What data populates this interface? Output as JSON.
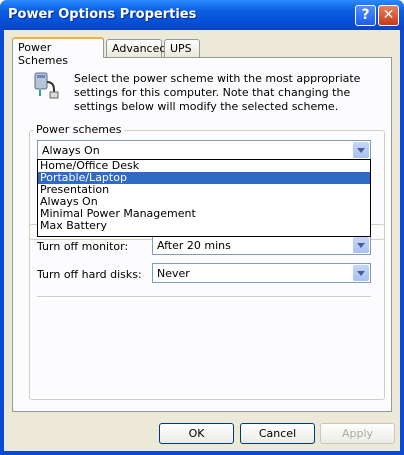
{
  "window": {
    "title": "Power Options Properties"
  },
  "titlebar": {
    "help": "?",
    "close": "✕"
  },
  "tabs": [
    "Power Schemes",
    "Advanced",
    "UPS"
  ],
  "intro_text": "Select the power scheme with the most appropriate settings for this computer. Note that changing the settings below will modify the selected scheme.",
  "power_schemes": {
    "legend": "Power schemes",
    "selected": "Always On",
    "options": [
      "Home/Office Desk",
      "Portable/Laptop",
      "Presentation",
      "Always On",
      "Minimal Power Management",
      "Max Battery"
    ],
    "highlighted_index": 1
  },
  "settings": {
    "monitor_label": "Turn off monitor:",
    "monitor_value": "After 20 mins",
    "disks_label": "Turn off hard disks:",
    "disks_value": "Never"
  },
  "buttons": {
    "ok": "OK",
    "cancel": "Cancel",
    "apply": "Apply"
  },
  "colors": {
    "title_bar": "#0550d8",
    "dialog_bg": "#ece9d8",
    "selection": "#316ac5"
  }
}
